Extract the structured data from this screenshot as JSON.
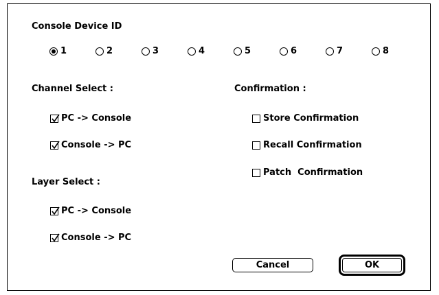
{
  "console_device": {
    "heading": "Console Device ID",
    "options": [
      "1",
      "2",
      "3",
      "4",
      "5",
      "6",
      "7",
      "8"
    ],
    "selected": "1"
  },
  "channel_select": {
    "heading": "Channel Select :",
    "items": [
      {
        "label": "PC -> Console",
        "checked": true
      },
      {
        "label": "Console -> PC",
        "checked": true
      }
    ]
  },
  "layer_select": {
    "heading": "Layer Select :",
    "items": [
      {
        "label": "PC -> Console",
        "checked": true
      },
      {
        "label": "Console -> PC",
        "checked": true
      }
    ]
  },
  "confirmation": {
    "heading": "Confirmation :",
    "items": [
      {
        "label": "Store Confirmation",
        "checked": false
      },
      {
        "label": "Recall Confirmation",
        "checked": false
      },
      {
        "label": "Patch  Confirmation",
        "checked": false
      }
    ]
  },
  "buttons": {
    "cancel_label": "Cancel",
    "ok_label": "OK"
  }
}
